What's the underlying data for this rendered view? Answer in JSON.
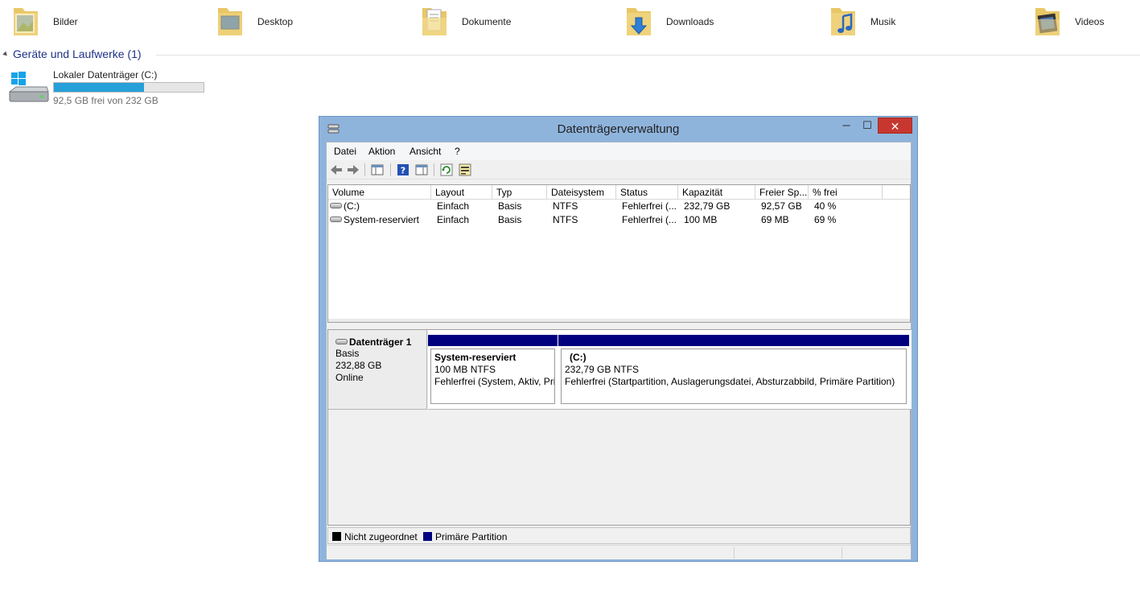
{
  "explorer": {
    "folders": [
      {
        "label": "Bilder",
        "icon": "pictures-folder-icon"
      },
      {
        "label": "Desktop",
        "icon": "desktop-folder-icon"
      },
      {
        "label": "Dokumente",
        "icon": "documents-folder-icon"
      },
      {
        "label": "Downloads",
        "icon": "downloads-folder-icon"
      },
      {
        "label": "Musik",
        "icon": "music-folder-icon"
      },
      {
        "label": "Videos",
        "icon": "videos-folder-icon"
      }
    ],
    "group_title": "Geräte und Laufwerke (1)",
    "drive": {
      "name": "Lokaler Datenträger (C:)",
      "free_text": "92,5 GB frei von 232 GB",
      "used_fraction": 0.6
    }
  },
  "window": {
    "title": "Datenträgerverwaltung",
    "controls": {
      "minimize": "─",
      "maximize": "☐",
      "close": "✕"
    },
    "menu": [
      "Datei",
      "Aktion",
      "Ansicht",
      "?"
    ],
    "volume_columns": [
      "Volume",
      "Layout",
      "Typ",
      "Dateisystem",
      "Status",
      "Kapazität",
      "Freier Sp...",
      "% frei"
    ],
    "volumes": [
      {
        "volume": "(C:)",
        "layout": "Einfach",
        "typ": "Basis",
        "fs": "NTFS",
        "status": "Fehlerfrei (...",
        "capacity": "232,79 GB",
        "free": "92,57 GB",
        "pct": "40 %"
      },
      {
        "volume": "System-reserviert",
        "layout": "Einfach",
        "typ": "Basis",
        "fs": "NTFS",
        "status": "Fehlerfrei (...",
        "capacity": "100 MB",
        "free": "69 MB",
        "pct": "69 %"
      }
    ],
    "disk": {
      "name": "Datenträger 1",
      "type": "Basis",
      "size": "232,88 GB",
      "state": "Online",
      "partitions": [
        {
          "title": "System-reserviert",
          "size_fs": "100 MB NTFS",
          "status": "Fehlerfrei (System, Aktiv, Pri"
        },
        {
          "title": "(C:)",
          "size_fs": "232,79 GB NTFS",
          "status": "Fehlerfrei (Startpartition, Auslagerungsdatei, Absturzabbild, Primäre Partition)"
        }
      ]
    },
    "legend": [
      {
        "label": "Nicht zugeordnet",
        "color": "#000000"
      },
      {
        "label": "Primäre Partition",
        "color": "#00007f"
      }
    ]
  }
}
